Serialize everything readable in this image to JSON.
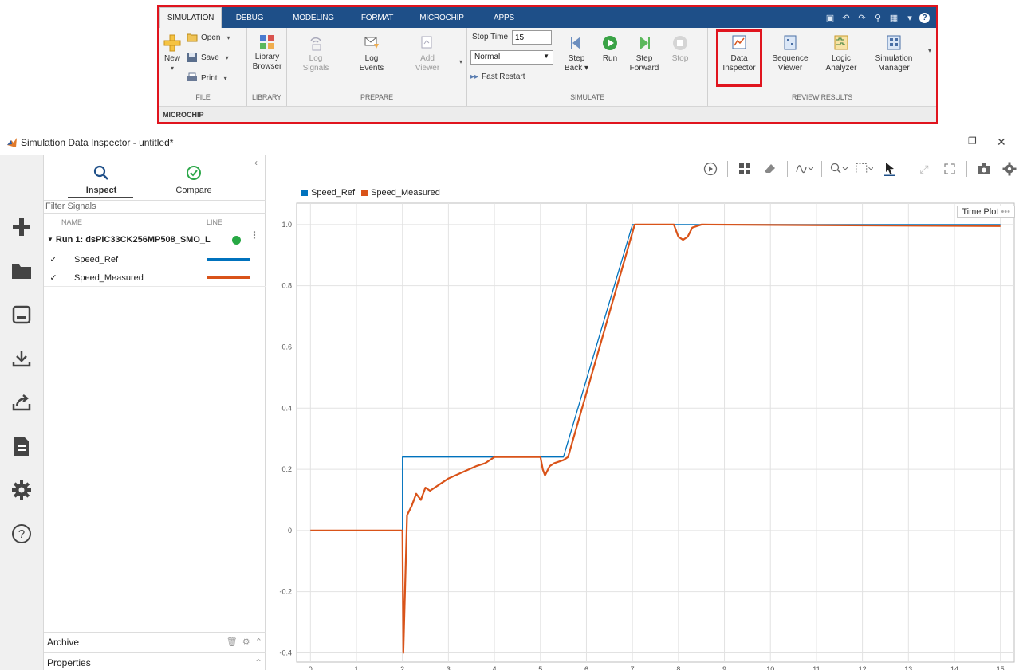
{
  "ribbon": {
    "tabs": [
      "SIMULATION",
      "DEBUG",
      "MODELING",
      "FORMAT",
      "MICROCHIP",
      "APPS"
    ],
    "file": {
      "new_label": "New",
      "open_label": "Open",
      "save_label": "Save",
      "print_label": "Print",
      "group_label": "FILE"
    },
    "library": {
      "browser_label_1": "Library",
      "browser_label_2": "Browser",
      "group_label": "LIBRARY"
    },
    "prepare": {
      "log_signals_1": "Log",
      "log_signals_2": "Signals",
      "log_events_1": "Log",
      "log_events_2": "Events",
      "add_viewer_1": "Add",
      "add_viewer_2": "Viewer",
      "group_label": "PREPARE"
    },
    "simulate": {
      "stop_time_label": "Stop Time",
      "stop_time_value": "15",
      "mode_value": "Normal",
      "fast_restart_label": "Fast Restart",
      "step_back_1": "Step",
      "step_back_2": "Back",
      "run_label": "Run",
      "step_forward_1": "Step",
      "step_forward_2": "Forward",
      "stop_label": "Stop",
      "group_label": "SIMULATE"
    },
    "review": {
      "data_inspector_1": "Data",
      "data_inspector_2": "Inspector",
      "sequence_viewer_1": "Sequence",
      "sequence_viewer_2": "Viewer",
      "logic_analyzer_1": "Logic",
      "logic_analyzer_2": "Analyzer",
      "simulation_manager_1": "Simulation",
      "simulation_manager_2": "Manager",
      "group_label": "REVIEW RESULTS"
    },
    "footer_label": "MICROCHIP",
    "highlight_color": "#e0141e",
    "tabbar_color": "#1e4f88"
  },
  "window": {
    "title": "Simulation Data Inspector - untitled*"
  },
  "signal_panel": {
    "inspect_label": "Inspect",
    "compare_label": "Compare",
    "filter_placeholder": "Filter Signals",
    "col_name": "NAME",
    "col_line": "LINE",
    "run_label": "Run 1: dsPIC33CK256MP508_SMO_L",
    "signals": [
      {
        "name": "Speed_Ref",
        "checked": "✓",
        "color": "#0072bd"
      },
      {
        "name": "Speed_Measured",
        "checked": "✓",
        "color": "#d95319"
      }
    ],
    "archive_label": "Archive",
    "properties_label": "Properties"
  },
  "plot": {
    "time_plot_label": "Time Plot",
    "toolbar_icons": [
      "play-icon",
      "layout-icon",
      "eraser-icon",
      "signal-icon",
      "zoom-icon",
      "fit-icon",
      "cursor-icon",
      "expand-icon",
      "fullscreen-icon",
      "camera-icon",
      "gear-icon"
    ]
  },
  "chart_data": {
    "type": "line",
    "title": "",
    "xlabel": "",
    "ylabel": "",
    "xlim": [
      -0.3,
      15.3
    ],
    "ylim": [
      -0.43,
      1.07
    ],
    "xticks": [
      0,
      1,
      2,
      3,
      4,
      5,
      6,
      7,
      8,
      9,
      10,
      11,
      12,
      13,
      14,
      15
    ],
    "yticks": [
      -0.4,
      -0.2,
      0,
      0.2,
      0.4,
      0.6,
      0.8,
      1.0
    ],
    "ytick_labels": [
      "-0.4",
      "-0.2",
      "0",
      "0.2",
      "0.4",
      "0.6",
      "0.8",
      "1.0"
    ],
    "grid": true,
    "legend_position": "top-left",
    "series": [
      {
        "name": "Speed_Ref",
        "color": "#0072bd",
        "x": [
          0,
          2.0,
          2.0,
          5.5,
          7.0,
          15.0
        ],
        "y": [
          0,
          0,
          0.24,
          0.24,
          1.0,
          1.0
        ]
      },
      {
        "name": "Speed_Measured",
        "color": "#d95319",
        "x": [
          0,
          2.0,
          2.02,
          2.1,
          2.2,
          2.3,
          2.4,
          2.5,
          2.6,
          2.8,
          3.0,
          3.3,
          3.6,
          3.8,
          4.0,
          4.5,
          5.0,
          5.05,
          5.1,
          5.2,
          5.3,
          5.5,
          5.6,
          7.05,
          7.5,
          7.9,
          8.0,
          8.1,
          8.2,
          8.3,
          8.5,
          15.0
        ],
        "y": [
          0,
          0,
          -0.4,
          0.05,
          0.08,
          0.12,
          0.1,
          0.14,
          0.13,
          0.15,
          0.17,
          0.19,
          0.21,
          0.22,
          0.24,
          0.24,
          0.24,
          0.2,
          0.18,
          0.21,
          0.22,
          0.23,
          0.24,
          1.0,
          1.0,
          1.0,
          0.96,
          0.95,
          0.96,
          0.99,
          1.0,
          0.995
        ]
      }
    ]
  }
}
